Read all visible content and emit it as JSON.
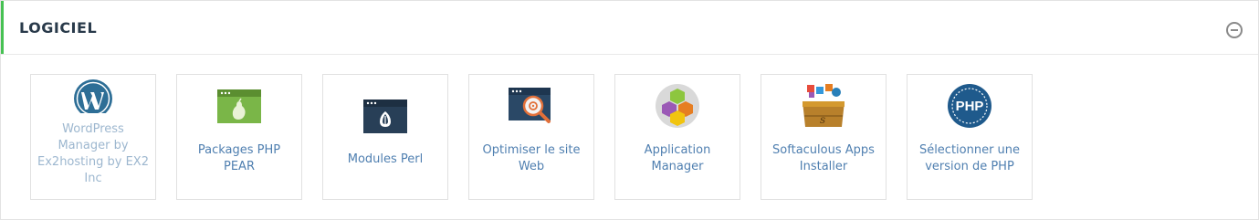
{
  "panel": {
    "title": "LOGICIEL",
    "collapse_icon": "minus-circle-icon"
  },
  "items": [
    {
      "label": "WordPress Manager by Ex2hosting by EX2 Inc",
      "icon": "wordpress-icon",
      "enabled": false
    },
    {
      "label": "Packages PHP PEAR",
      "icon": "php-pear-icon",
      "enabled": true
    },
    {
      "label": "Modules Perl",
      "icon": "perl-modules-icon",
      "enabled": true
    },
    {
      "label": "Optimiser le site Web",
      "icon": "optimize-website-icon",
      "enabled": true
    },
    {
      "label": "Application Manager",
      "icon": "application-manager-icon",
      "enabled": true
    },
    {
      "label": "Softaculous Apps Installer",
      "icon": "softaculous-icon",
      "enabled": true
    },
    {
      "label": "Sélectionner une version de PHP",
      "icon": "php-version-icon",
      "enabled": true
    }
  ],
  "colors": {
    "accent": "#47c153",
    "link": "#4f7fb0",
    "link_disabled": "#9db7cf",
    "title": "#293a4a"
  }
}
